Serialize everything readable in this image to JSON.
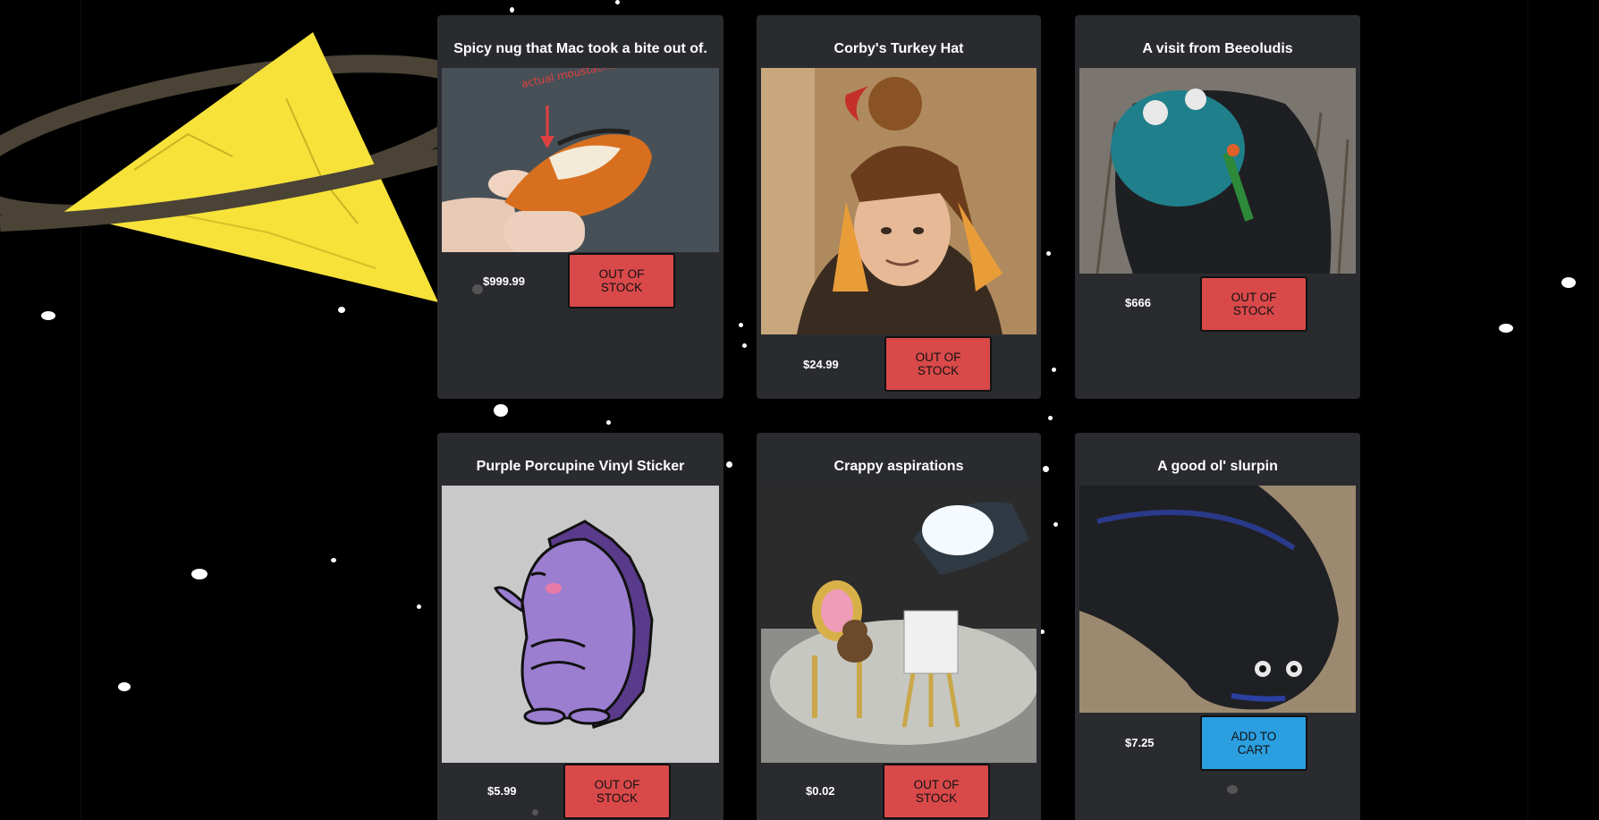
{
  "products": [
    {
      "title": "Spicy nug that Mac took a bite out of.",
      "price": "$999.99",
      "button": "OUT OF STOCK",
      "in_stock": false,
      "image_caption": "actual moustache hair!"
    },
    {
      "title": "Corby's Turkey Hat",
      "price": "$24.99",
      "button": "OUT OF STOCK",
      "in_stock": false
    },
    {
      "title": "A visit from Beeoludis",
      "price": "$666",
      "button": "OUT OF STOCK",
      "in_stock": false
    },
    {
      "title": "Purple Porcupine Vinyl Sticker",
      "price": "$5.99",
      "button": "OUT OF STOCK",
      "in_stock": false
    },
    {
      "title": "Crappy aspirations",
      "price": "$0.02",
      "button": "OUT OF STOCK",
      "in_stock": false
    },
    {
      "title": "A good ol' slurpin",
      "price": "$7.25",
      "button": "ADD TO CART",
      "in_stock": true
    }
  ],
  "colors": {
    "page_bg": "#000000",
    "card_bg": "#2a2b2f",
    "out_of_stock_button": "#d9494a",
    "add_to_cart_button": "#2b9fe0",
    "deco_triangle": "#f7e23a",
    "deco_ring": "#4a4336"
  }
}
